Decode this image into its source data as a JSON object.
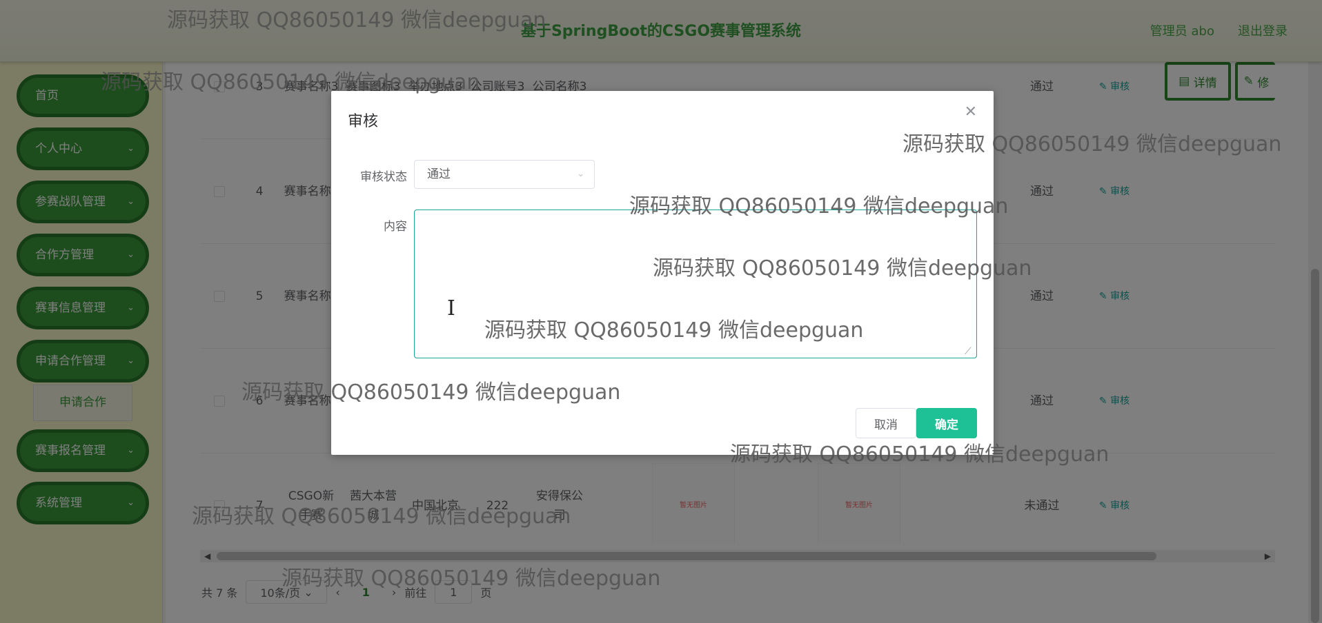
{
  "header": {
    "title": "基于SpringBoot的CSGO赛事管理系统",
    "user": "管理员 abo",
    "logout": "退出登录"
  },
  "sidebar": {
    "items": [
      {
        "label": "首页",
        "chevron": false
      },
      {
        "label": "个人中心",
        "chevron": true
      },
      {
        "label": "参赛战队管理",
        "chevron": true
      },
      {
        "label": "合作方管理",
        "chevron": true
      },
      {
        "label": "赛事信息管理",
        "chevron": true
      },
      {
        "label": "申请合作管理",
        "chevron": true
      },
      {
        "label": "赛事报名管理",
        "chevron": true
      },
      {
        "label": "系统管理",
        "chevron": true
      }
    ],
    "submenu": "申请合作"
  },
  "table": {
    "rows": [
      {
        "index": "3",
        "name": "赛事名称3",
        "icon": "赛事图标3",
        "location": "举办地点3",
        "account": "公司账号3",
        "company": "公司名称3",
        "status": "通过"
      },
      {
        "index": "4",
        "name": "赛事名称4",
        "icon": "",
        "location": "",
        "account": "",
        "company": "",
        "status": "通过"
      },
      {
        "index": "5",
        "name": "赛事名称5",
        "icon": "",
        "location": "",
        "account": "",
        "company": "",
        "status": "通过"
      },
      {
        "index": "6",
        "name": "赛事名称6",
        "icon": "",
        "location": "",
        "account": "",
        "company": "",
        "status": "通过"
      },
      {
        "index": "7",
        "name": "CSGO新手赛",
        "icon": "茜大本营城",
        "location": "中国北京",
        "account": "222",
        "company": "安得保公司",
        "status": "未通过"
      }
    ],
    "audit_label": "审核",
    "detail_label": "详情",
    "edit_label": "修",
    "image_placeholder": "暂无图片"
  },
  "pagination": {
    "total": "共 7 条",
    "page_size": "10条/页",
    "prev": "‹",
    "current": "1",
    "next": "›",
    "goto": "前往",
    "goto_value": "1",
    "page_unit": "页"
  },
  "dialog": {
    "title": "审核",
    "status_label": "审核状态",
    "status_value": "通过",
    "content_label": "内容",
    "content_value": "",
    "cancel": "取消",
    "confirm": "确定"
  },
  "watermark": "源码获取 QQ86050149 微信deepguan"
}
